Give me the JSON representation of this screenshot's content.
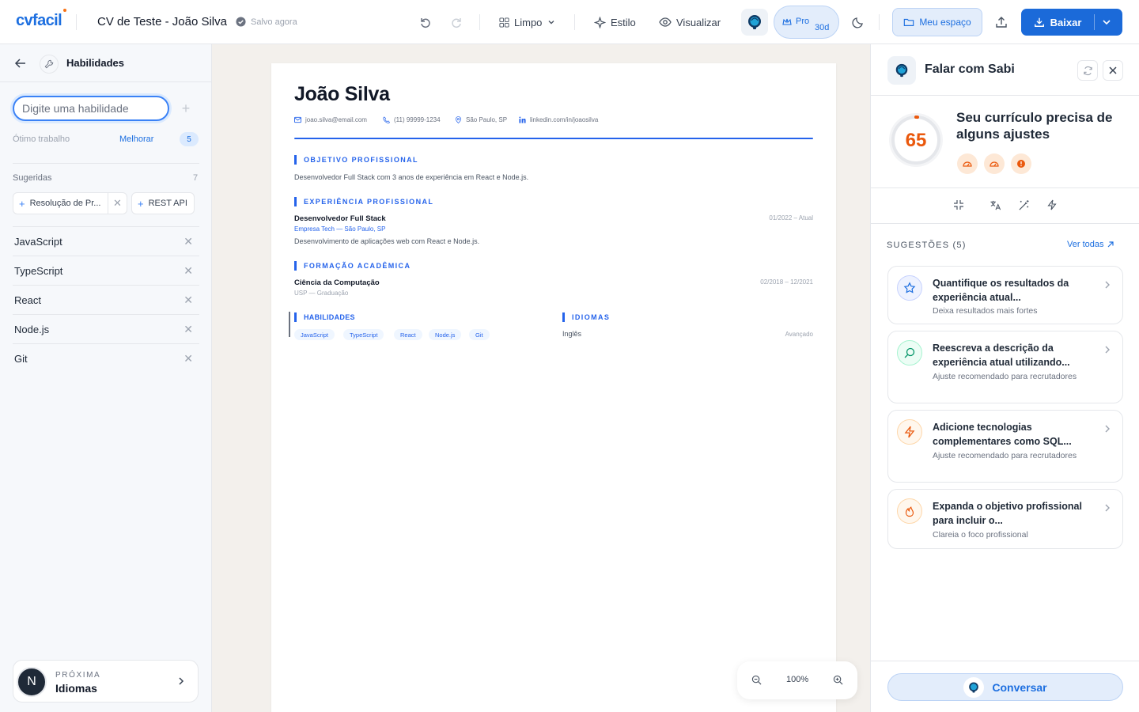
{
  "topbar": {
    "logo": "cvfacil",
    "doc_title": "CV de Teste - João Silva",
    "saved": "Salvo agora",
    "template": "Limpo",
    "style": "Estilo",
    "preview": "Visualizar",
    "pro": "Pro",
    "pro_days": "30d",
    "my_space": "Meu espaço",
    "download": "Baixar"
  },
  "left": {
    "title": "Habilidades",
    "input_placeholder": "Digite uma habilidade",
    "add_symbol": "+",
    "score_text": "Ótimo trabalho",
    "improve": "Melhorar",
    "score_badge": "5",
    "suggested_label": "Sugeridas",
    "suggested_count": "7",
    "suggested_chips": [
      "Resolução de Pr...",
      "REST API"
    ],
    "skills": [
      "JavaScript",
      "TypeScript",
      "React",
      "Node.js",
      "Git"
    ],
    "next_label": "PRÓXIMA",
    "next_value": "Idiomas",
    "next_initial": "N"
  },
  "cv": {
    "name": "João Silva",
    "email": "joao.silva@email.com",
    "phone": "(11) 99999-1234",
    "location": "São Paulo, SP",
    "linkedin": "linkedin.com/in/joaosilva",
    "objective_title": "OBJETIVO PROFISSIONAL",
    "objective_text": "Desenvolvedor Full Stack com 3 anos de experiência em React e Node.js.",
    "experience_title": "EXPERIÊNCIA PROFISSIONAL",
    "job_title": "Desenvolvedor Full Stack",
    "job_company": "Empresa Tech — São Paulo, SP",
    "job_dates": "01/2022 – Atual",
    "job_desc": "Desenvolvimento de aplicações web com React e Node.js.",
    "education_title": "FORMAÇÃO ACADÊMICA",
    "degree": "Ciência da Computação",
    "school": "USP — Graduação",
    "edu_dates": "02/2018 – 12/2021",
    "skills_title": "HABILIDADES",
    "skills": [
      "JavaScript",
      "TypeScript",
      "React",
      "Node.js",
      "Git"
    ],
    "languages_title": "IDIOMAS",
    "language": "Inglês",
    "language_level": "Avançado"
  },
  "zoom": {
    "value": "100%"
  },
  "right": {
    "title": "Falar com Sabi",
    "score": "65",
    "score_title": "Seu currículo precisa de alguns ajustes",
    "suggestions_header": "SUGESTÕES (5)",
    "see_all": "Ver todas",
    "cards": [
      {
        "title": "Quantifique os resultados da experiência atual...",
        "subtitle": "Deixa resultados mais fortes"
      },
      {
        "title": "Reescreva a descrição da experiência atual utilizando...",
        "subtitle": "Ajuste recomendado para recrutadores"
      },
      {
        "title": "Adicione tecnologias complementares como SQL...",
        "subtitle": "Ajuste recomendado para recrutadores"
      },
      {
        "title": "Expanda o objetivo profissional para incluir o...",
        "subtitle": "Clareia o foco profissional"
      }
    ],
    "chat_button": "Conversar"
  },
  "colors": {
    "brand": "#1d6fe0",
    "accent_orange": "#ea580c",
    "canvas_bg": "#f3f0ec"
  }
}
